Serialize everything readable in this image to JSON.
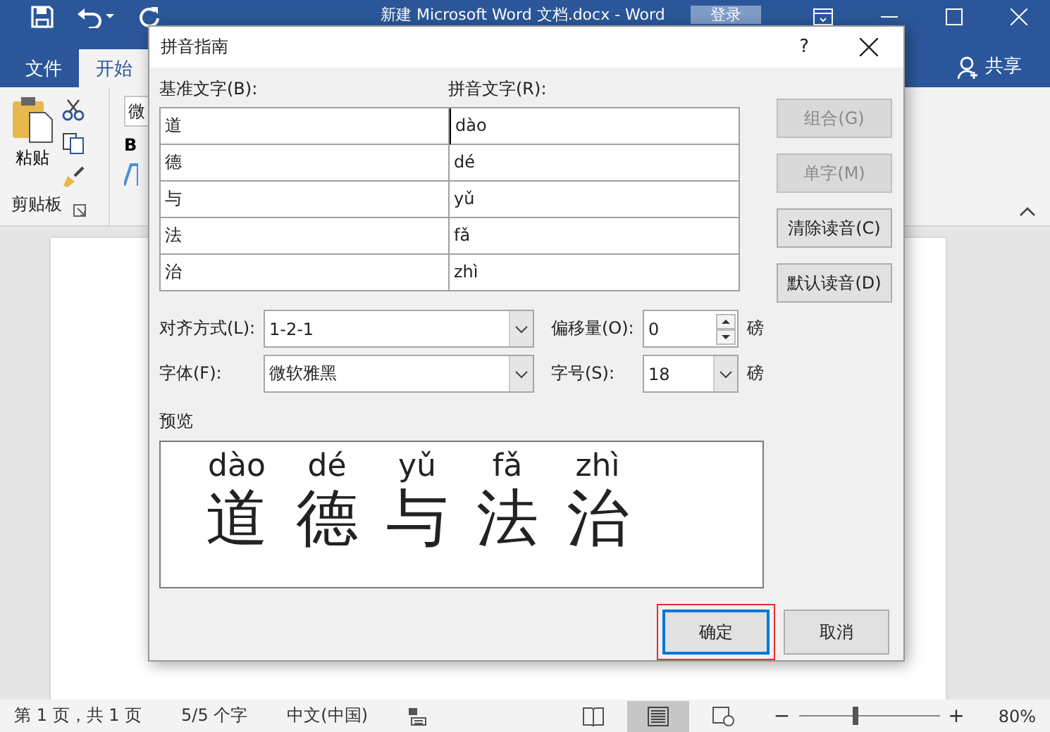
{
  "window": {
    "title": "新建 Microsoft Word 文档.docx  -  Word",
    "login": "登录"
  },
  "ribbon_tabs": [
    {
      "label": "文件",
      "selected": false
    },
    {
      "label": "开始",
      "selected": true
    }
  ],
  "share": "共享",
  "clipboard": {
    "paste": "粘贴",
    "group": "剪贴板"
  },
  "font_field": {
    "value": "微"
  },
  "bold_button": "B",
  "dialog": {
    "title": "拼音指南",
    "help": "?",
    "base_label": "基准文字(B):",
    "pinyin_label": "拼音文字(R):",
    "rows": [
      {
        "base": "道",
        "pinyin": "dào"
      },
      {
        "base": "德",
        "pinyin": "dé"
      },
      {
        "base": "与",
        "pinyin": "yǔ"
      },
      {
        "base": "法",
        "pinyin": "fǎ"
      },
      {
        "base": "治",
        "pinyin": "zhì"
      }
    ],
    "side_buttons": [
      {
        "label": "组合(G)",
        "disabled": true
      },
      {
        "label": "单字(M)",
        "disabled": true
      },
      {
        "label": "清除读音(C)",
        "disabled": false
      },
      {
        "label": "默认读音(D)",
        "disabled": false
      }
    ],
    "alignment": {
      "label": "对齐方式(L):",
      "value": "1-2-1"
    },
    "offset": {
      "label": "偏移量(O):",
      "value": "0",
      "unit": "磅"
    },
    "font": {
      "label": "字体(F):",
      "value": "微软雅黑"
    },
    "size": {
      "label": "字号(S):",
      "value": "18",
      "unit": "磅"
    },
    "preview_label": "预览",
    "preview": [
      {
        "base": "道",
        "pinyin": "dào"
      },
      {
        "base": "德",
        "pinyin": "dé"
      },
      {
        "base": "与",
        "pinyin": "yǔ"
      },
      {
        "base": "法",
        "pinyin": "fǎ"
      },
      {
        "base": "治",
        "pinyin": "zhì"
      }
    ],
    "ok": "确定",
    "cancel": "取消"
  },
  "status_bar": {
    "page": "第 1 页，共 1 页",
    "words": "5/5 个字",
    "language": "中文(中国)",
    "zoom_out": "−",
    "zoom_slider": {
      "level": 0.4
    },
    "zoom_in": "+",
    "zoom": "80%"
  }
}
